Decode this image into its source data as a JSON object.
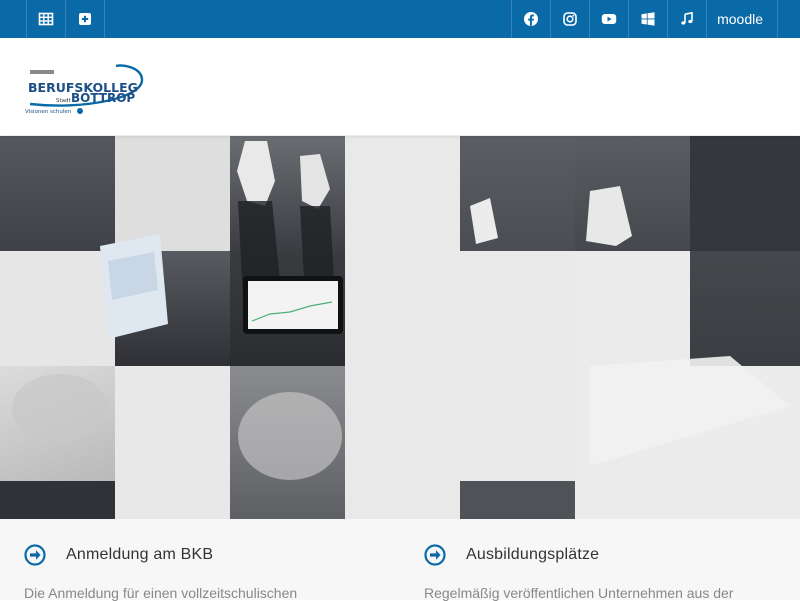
{
  "topbar": {
    "left_icons": [
      {
        "icon": "table-icon"
      },
      {
        "icon": "plus-square-icon"
      }
    ],
    "right_icons": [
      {
        "icon": "facebook-icon"
      },
      {
        "icon": "instagram-icon"
      },
      {
        "icon": "youtube-icon"
      },
      {
        "icon": "windows-icon"
      },
      {
        "icon": "music-note-icon"
      }
    ],
    "moodle_label": "moodle",
    "bg_color": "#0a6aa8"
  },
  "header": {
    "logo": {
      "line1": "BERUFSKOLLEG",
      "line2_small": "Stadt",
      "line2": "BOTTROP",
      "tagline": "Visionen schulen"
    }
  },
  "cards": [
    {
      "title": "Anmeldung am BKB",
      "text": "Die Anmeldung für einen vollzeitschulischen"
    },
    {
      "title": "Ausbildungsplätze",
      "text": "Regelmäßig veröffentlichen Unternehmen aus der"
    }
  ],
  "accent_color": "#0a6aa8"
}
